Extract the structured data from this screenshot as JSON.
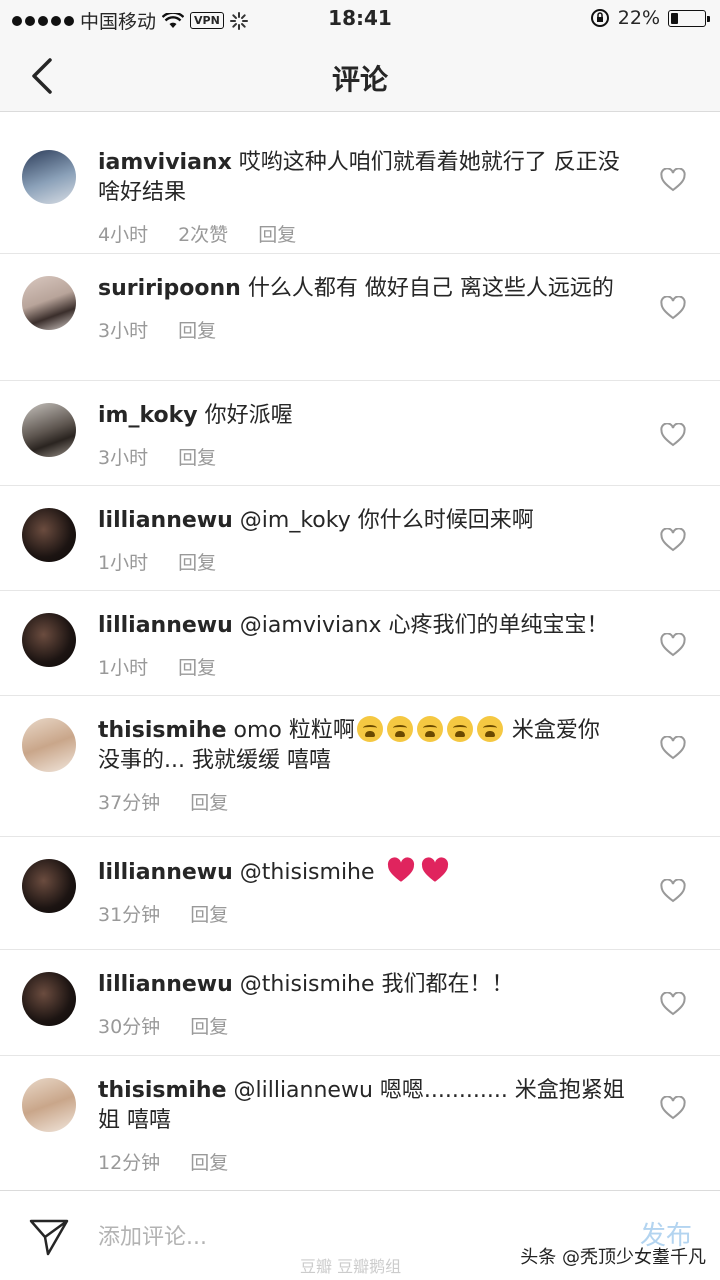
{
  "status_bar": {
    "carrier": "中国移动",
    "vpn": "VPN",
    "time": "18:41",
    "battery_text": "22%",
    "battery_level": 0.22
  },
  "nav": {
    "title": "评论"
  },
  "comments": [
    {
      "user": "iamvivianx",
      "text": "哎哟这种人咱们就看着她就行了 反正没啥好结果",
      "time": "4小时",
      "likes": "2次赞",
      "reply": "回复"
    },
    {
      "user": "suriripoonn",
      "text": "什么人都有 做好自己 离这些人远远的",
      "time": "3小时",
      "reply": "回复"
    },
    {
      "user": "im_koky",
      "text": "你好派喔",
      "time": "3小时",
      "reply": "回复"
    },
    {
      "user": "lilliannewu",
      "text": "@im_koky 你什么时候回来啊",
      "time": "1小时",
      "reply": "回复"
    },
    {
      "user": "lilliannewu",
      "text": "@iamvivianx 心疼我们的单纯宝宝！",
      "time": "1小时",
      "reply": "回复"
    },
    {
      "user": "thisismihe",
      "text_a": "omo 粒粒啊",
      "text_b": "米盒爱你 没事的... 我就缓缓 嘻嘻",
      "emoji_name": "loudly-crying-face-emoji",
      "time": "37分钟",
      "reply": "回复"
    },
    {
      "user": "lilliannewu",
      "text": "@thisismihe",
      "emoji_name": "red-heart-emoji",
      "time": "31分钟",
      "reply": "回复"
    },
    {
      "user": "lilliannewu",
      "text": "@thisismihe 我们都在！！",
      "time": "30分钟",
      "reply": "回复"
    },
    {
      "user": "thisismihe",
      "text": "@lilliannewu 嗯嗯............ 米盒抱紧姐姐 嘻嘻",
      "time": "12分钟",
      "reply": "回复"
    }
  ],
  "composer": {
    "placeholder": "添加评论...",
    "publish_label": "发布"
  },
  "watermarks": {
    "toutiao": "头条 @秃顶少女耋千凡",
    "douban": "豆瓣 豆瓣鹅组"
  },
  "colors": {
    "username": "#262626",
    "meta": "#999999",
    "publish_disabled": "#b3d4f0",
    "heart": "#e0245e"
  },
  "icons": {
    "back": "chevron-left-icon",
    "like": "heart-outline-icon",
    "send": "paper-plane-icon"
  }
}
